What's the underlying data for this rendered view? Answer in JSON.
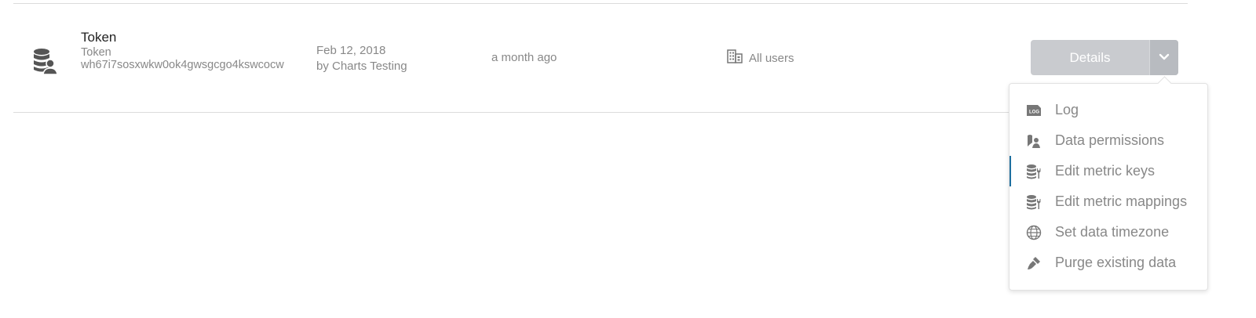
{
  "row": {
    "name": "Token",
    "type_label": "Token",
    "token_id": "wh67i7sosxwkw0ok4gwsgcgo4kswcocw",
    "created_date": "Feb 12, 2018",
    "created_by": "by Charts Testing",
    "updated": "a month ago",
    "access": "All users",
    "icon": "database-user-icon"
  },
  "details_button": {
    "label": "Details"
  },
  "menu": {
    "items": [
      {
        "label": "Log",
        "icon": "log-icon"
      },
      {
        "label": "Data permissions",
        "icon": "key-user-icon"
      },
      {
        "label": "Edit metric keys",
        "icon": "database-wrench-icon",
        "active": true
      },
      {
        "label": "Edit metric mappings",
        "icon": "database-wrench-icon"
      },
      {
        "label": "Set data timezone",
        "icon": "globe-icon"
      },
      {
        "label": "Purge existing data",
        "icon": "brush-icon"
      }
    ]
  },
  "colors": {
    "accent": "#1e6f9f",
    "button": "#c9cbcf"
  }
}
